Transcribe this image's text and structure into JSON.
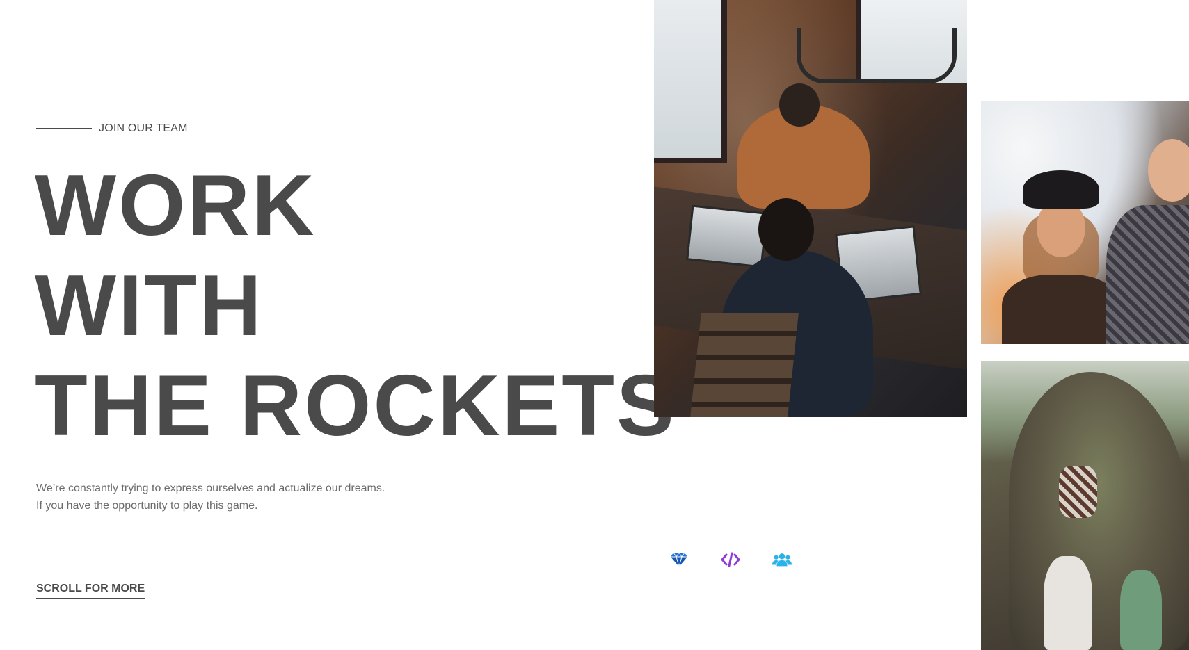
{
  "hero": {
    "eyebrow": "JOIN OUR TEAM",
    "headline_lines": [
      "WORK",
      "WITH",
      "THE ROCKETS"
    ],
    "lead_lines": [
      "We’re constantly trying to express ourselves and actualize our dreams.",
      "If you have the opportunity to play this game."
    ],
    "scroll_label": "SCROLL FOR MORE"
  },
  "icons": [
    {
      "name": "diamond-icon",
      "color": "#1f6fd6"
    },
    {
      "name": "code-icon",
      "color": "#8e3bd8"
    },
    {
      "name": "users-icon",
      "color": "#2ab3e8"
    }
  ],
  "photos": [
    {
      "name": "team-meeting-photo"
    },
    {
      "name": "laughing-friends-photo"
    },
    {
      "name": "rock-climbing-photo"
    }
  ]
}
